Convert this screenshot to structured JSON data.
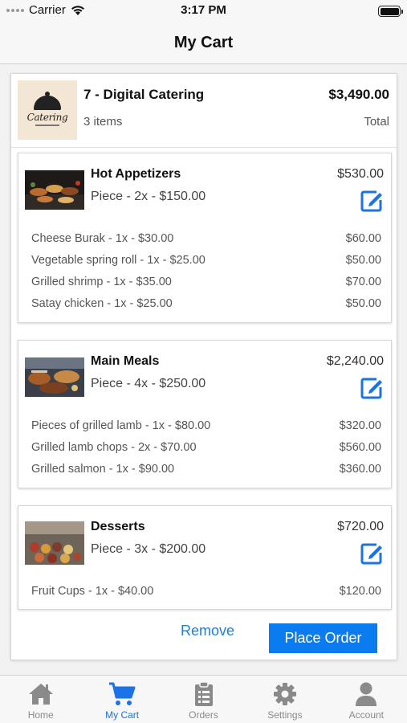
{
  "status_bar": {
    "carrier": "Carrier",
    "time": "3:17 PM"
  },
  "nav": {
    "title": "My Cart"
  },
  "store": {
    "name": "7 - Digital Catering",
    "item_count": "3 items",
    "total": "$3,490.00",
    "total_label": "Total",
    "logo_text": "Catering"
  },
  "sections": [
    {
      "name": "Hot Appetizers",
      "price_line": "Piece - 2x - $150.00",
      "total": "$530.00",
      "items": [
        {
          "label": "Cheese Burak - 1x - $30.00",
          "price": "$60.00"
        },
        {
          "label": "Vegetable spring roll - 1x - $25.00",
          "price": "$50.00"
        },
        {
          "label": "Grilled shrimp - 1x - $35.00",
          "price": "$70.00"
        },
        {
          "label": "Satay chicken - 1x - $25.00",
          "price": "$50.00"
        }
      ]
    },
    {
      "name": "Main Meals",
      "price_line": "Piece - 4x - $250.00",
      "total": "$2,240.00",
      "items": [
        {
          "label": "Pieces of grilled lamb - 1x - $80.00",
          "price": "$320.00"
        },
        {
          "label": "Grilled lamb chops - 2x - $70.00",
          "price": "$560.00"
        },
        {
          "label": "Grilled salmon - 1x - $90.00",
          "price": "$360.00"
        }
      ]
    },
    {
      "name": "Desserts",
      "price_line": "Piece - 3x - $200.00",
      "total": "$720.00",
      "items": [
        {
          "label": "Fruit Cups - 1x - $40.00",
          "price": "$120.00"
        }
      ]
    }
  ],
  "actions": {
    "remove": "Remove",
    "place_order": "Place Order"
  },
  "tabs": [
    {
      "label": "Home",
      "icon": "home-icon"
    },
    {
      "label": "My Cart",
      "icon": "cart-icon",
      "active": true
    },
    {
      "label": "Orders",
      "icon": "clipboard-icon"
    },
    {
      "label": "Settings",
      "icon": "gear-icon"
    },
    {
      "label": "Account",
      "icon": "user-icon"
    }
  ],
  "colors": {
    "accent": "#0a7cf0",
    "active_tab": "#1a73e8",
    "inactive_tab": "#8a8a8a"
  }
}
